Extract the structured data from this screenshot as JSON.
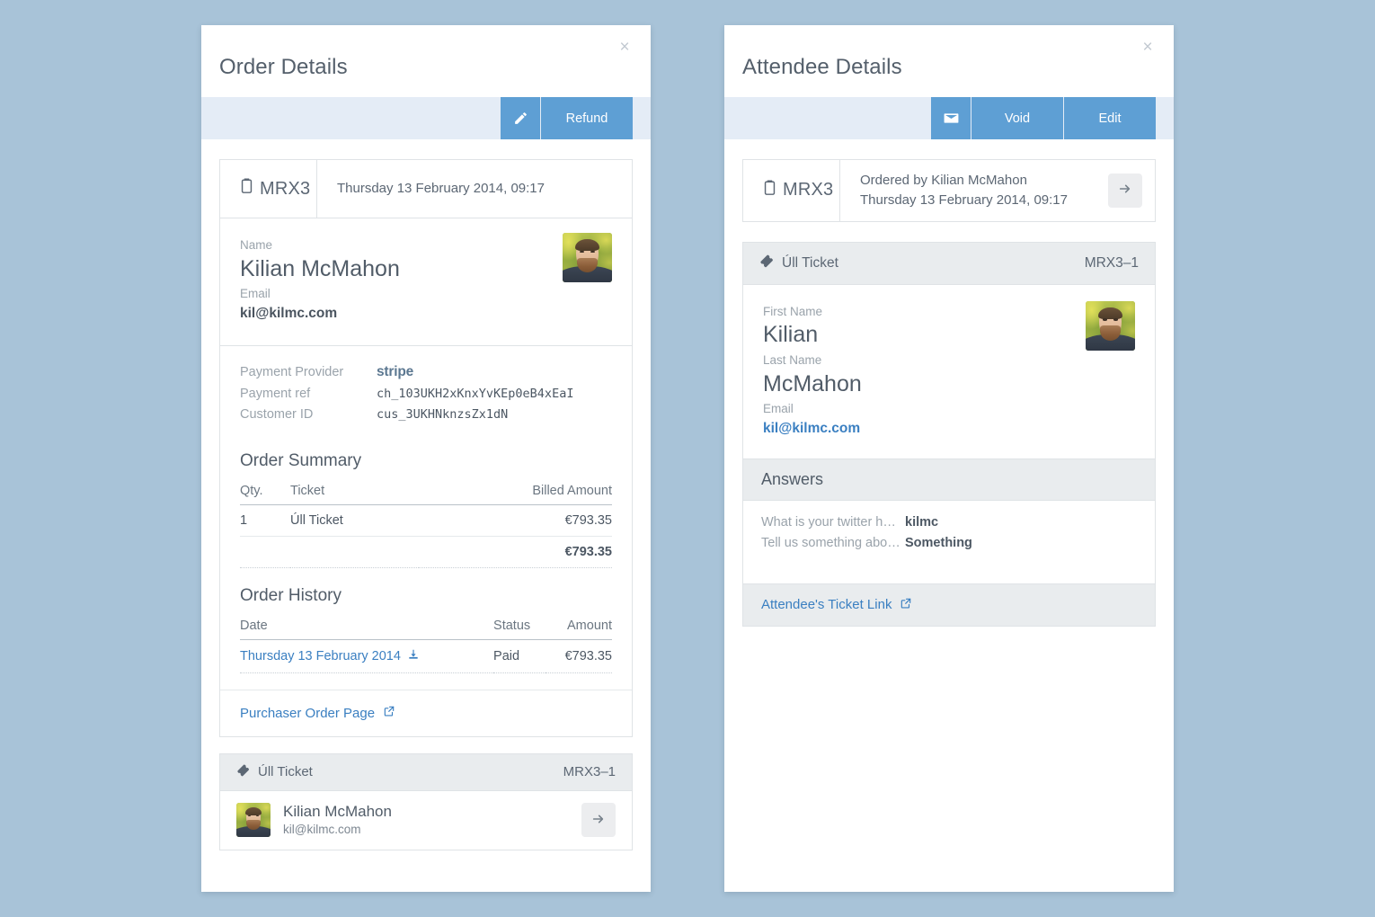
{
  "order_panel": {
    "title": "Order Details",
    "close_label": "×",
    "toolbar": {
      "edit_icon_name": "pencil-icon",
      "refund_label": "Refund"
    },
    "reference": {
      "code": "MRX3",
      "date": "Thursday 13 February 2014, 09:17"
    },
    "purchaser": {
      "name_label": "Name",
      "name": "Kilian McMahon",
      "email_label": "Email",
      "email": "kil@kilmc.com"
    },
    "payment": {
      "provider_label": "Payment Provider",
      "provider": "stripe",
      "ref_label": "Payment ref",
      "ref": "ch_103UKH2xKnxYvKEp0eB4xEaI",
      "customer_label": "Customer ID",
      "customer_id": "cus_3UKHNknzsZx1dN"
    },
    "order_summary": {
      "title": "Order Summary",
      "headers": [
        "Qty.",
        "Ticket",
        "Billed Amount"
      ],
      "rows": [
        {
          "qty": "1",
          "ticket": "Úll Ticket",
          "amount": "€793.35"
        }
      ],
      "total": "€793.35"
    },
    "order_history": {
      "title": "Order History",
      "headers": [
        "Date",
        "Status",
        "Amount"
      ],
      "rows": [
        {
          "date": "Thursday 13 February 2014",
          "status": "Paid",
          "amount": "€793.35"
        }
      ]
    },
    "purchaser_order_link": "Purchaser Order Page",
    "ticket_group": {
      "name": "Úll Ticket",
      "ref": "MRX3–1",
      "attendee_name": "Kilian McMahon",
      "attendee_email": "kil@kilmc.com"
    }
  },
  "attendee_panel": {
    "title": "Attendee Details",
    "close_label": "×",
    "toolbar": {
      "email_icon_name": "envelope-icon",
      "void_label": "Void",
      "edit_label": "Edit"
    },
    "reference": {
      "code": "MRX3",
      "ordered_by": "Ordered by Kilian McMahon",
      "date": "Thursday 13 February 2014, 09:17"
    },
    "ticket": {
      "name": "Úll Ticket",
      "ref": "MRX3–1",
      "first_name_label": "First Name",
      "first_name": "Kilian",
      "last_name_label": "Last Name",
      "last_name": "McMahon",
      "email_label": "Email",
      "email": "kil@kilmc.com"
    },
    "answers": {
      "title": "Answers",
      "rows": [
        {
          "question": "What is your twitter h…",
          "answer": "kilmc"
        },
        {
          "question": "Tell us something abo…",
          "answer": "Something"
        }
      ]
    },
    "ticket_link": "Attendee's Ticket Link"
  },
  "colors": {
    "page_background": "#a8c3d8",
    "button_blue": "#5e9fd4",
    "toolbar_blue": "#e4ecf6",
    "link_blue": "#3a7fc1",
    "heading_gray": "#515c68",
    "muted_gray": "#9aa3ab",
    "section_gray": "#e9ecee"
  }
}
